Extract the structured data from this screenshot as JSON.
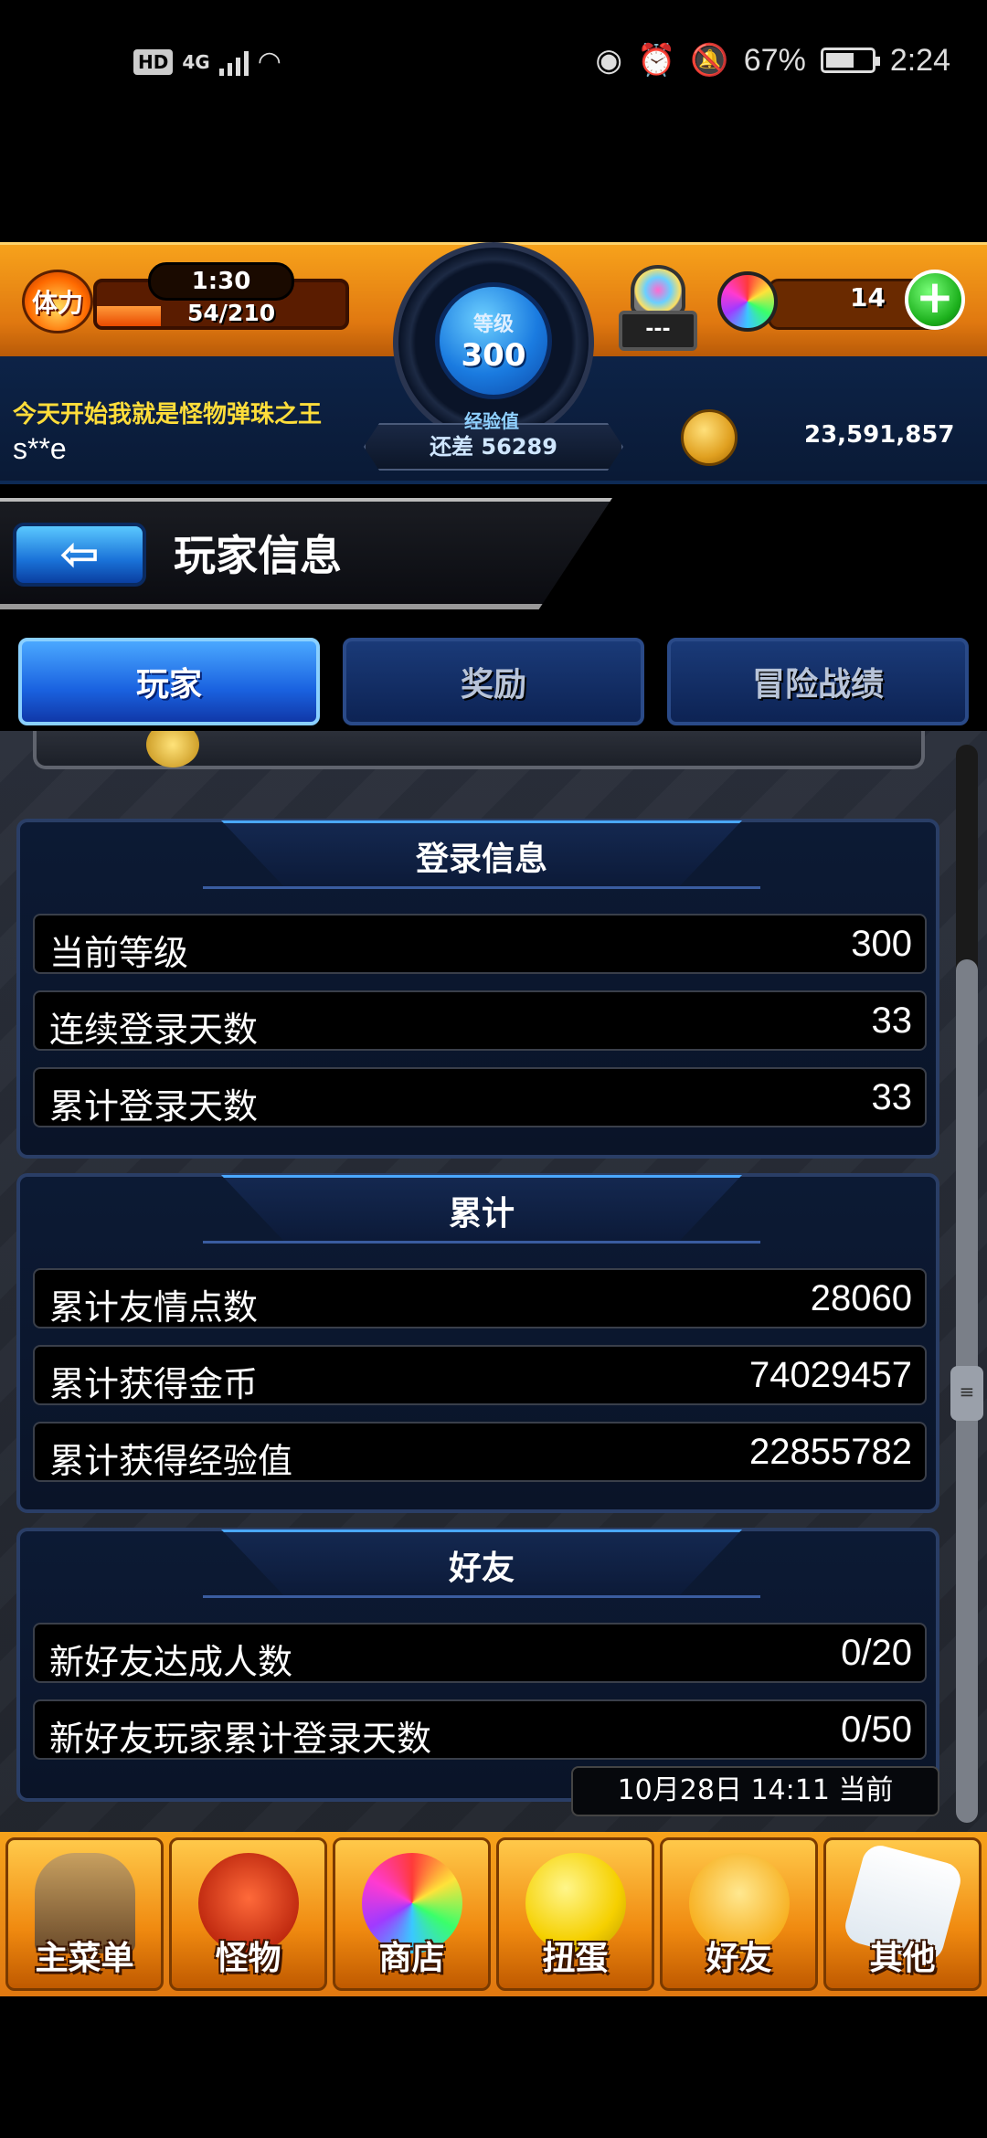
{
  "status_bar": {
    "hd": "HD",
    "network": "4G",
    "battery_percent": "67%",
    "battery_level": 0.67,
    "time": "2:24"
  },
  "hud": {
    "stamina_label": "体力",
    "stamina_timer": "1:30",
    "stamina_value": "54/210",
    "stamina_fraction": 0.257,
    "level_label": "等级",
    "level": "300",
    "exp_label": "经验值",
    "exp_remaining": "还差 56289",
    "machine_label": "---",
    "orb_count": "14",
    "plus": "+",
    "player_motto": "今天开始我就是怪物弹珠之王",
    "player_name": "s**e",
    "coins": "23,591,857"
  },
  "header": {
    "back_arrow": "⇦",
    "title": "玩家信息"
  },
  "tabs": [
    {
      "label": "玩家",
      "active": true
    },
    {
      "label": "奖励",
      "active": false
    },
    {
      "label": "冒险战绩",
      "active": false
    }
  ],
  "sections": [
    {
      "title": "登录信息",
      "rows": [
        {
          "label": "当前等级",
          "value": "300"
        },
        {
          "label": "连续登录天数",
          "value": "33"
        },
        {
          "label": "累计登录天数",
          "value": "33"
        }
      ]
    },
    {
      "title": "累计",
      "rows": [
        {
          "label": "累计友情点数",
          "value": "28060"
        },
        {
          "label": "累计获得金币",
          "value": "74029457"
        },
        {
          "label": "累计获得经验值",
          "value": "22855782"
        }
      ]
    },
    {
      "title": "好友",
      "rows": [
        {
          "label": "新好友达成人数",
          "value": "0/20"
        },
        {
          "label": "新好友玩家累计登录天数",
          "value": "0/50"
        }
      ]
    }
  ],
  "timestamp": "10月28日 14:11 当前",
  "bottom_nav": [
    {
      "label": "主菜单",
      "icon": "main-menu-icon"
    },
    {
      "label": "怪物",
      "icon": "monster-icon"
    },
    {
      "label": "商店",
      "icon": "shop-icon"
    },
    {
      "label": "扭蛋",
      "icon": "gacha-icon"
    },
    {
      "label": "好友",
      "icon": "friends-icon"
    },
    {
      "label": "其他",
      "icon": "other-icon"
    }
  ]
}
